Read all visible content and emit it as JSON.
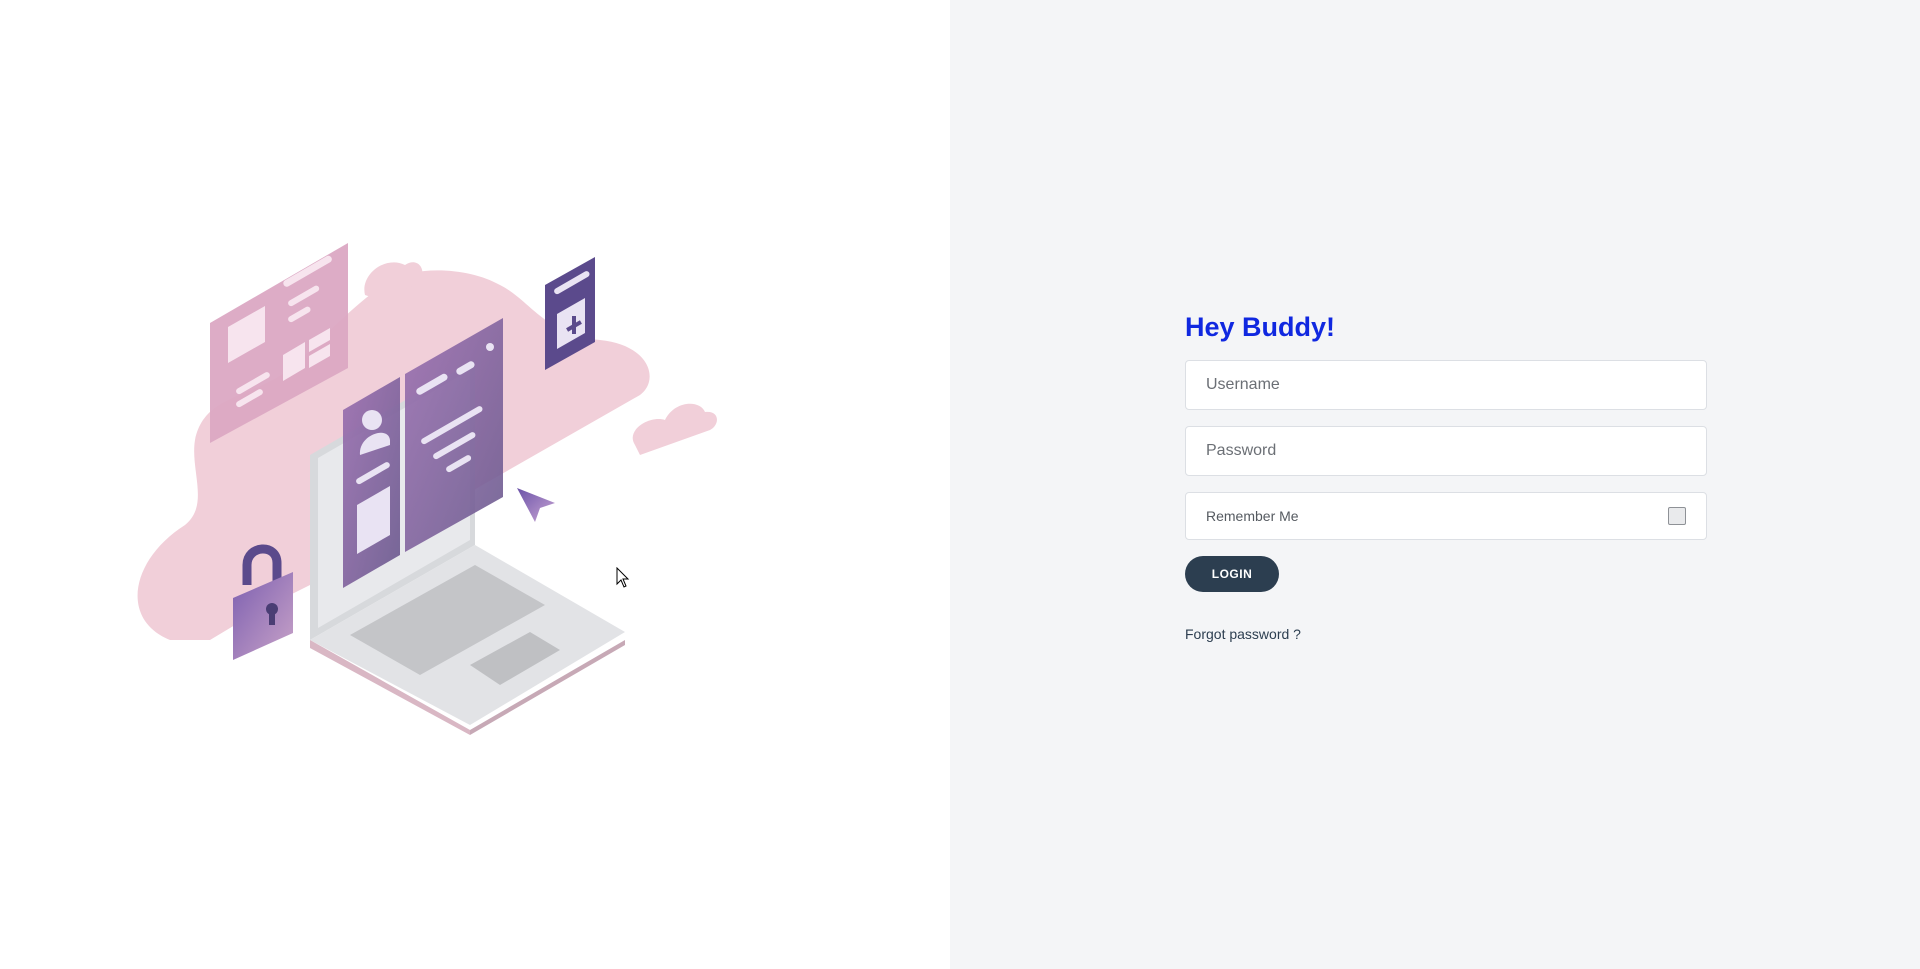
{
  "login": {
    "title": "Hey Buddy!",
    "username_placeholder": "Username",
    "password_placeholder": "Password",
    "remember_label": "Remember Me",
    "remember_checked": false,
    "login_label": "LOGIN",
    "forgot_label": "Forgot password ?"
  },
  "colors": {
    "title": "#1028e0",
    "button": "#2c3e50",
    "right_background": "#f4f5f7",
    "illustration_pink": "#f1cfd9",
    "illustration_purple": "#7c5a96"
  },
  "illustration": {
    "icons": [
      "cloud-icon",
      "laptop-icon",
      "profile-card-icon",
      "lock-icon",
      "pointer-arrow-icon",
      "add-card-icon",
      "document-card-icon"
    ]
  }
}
